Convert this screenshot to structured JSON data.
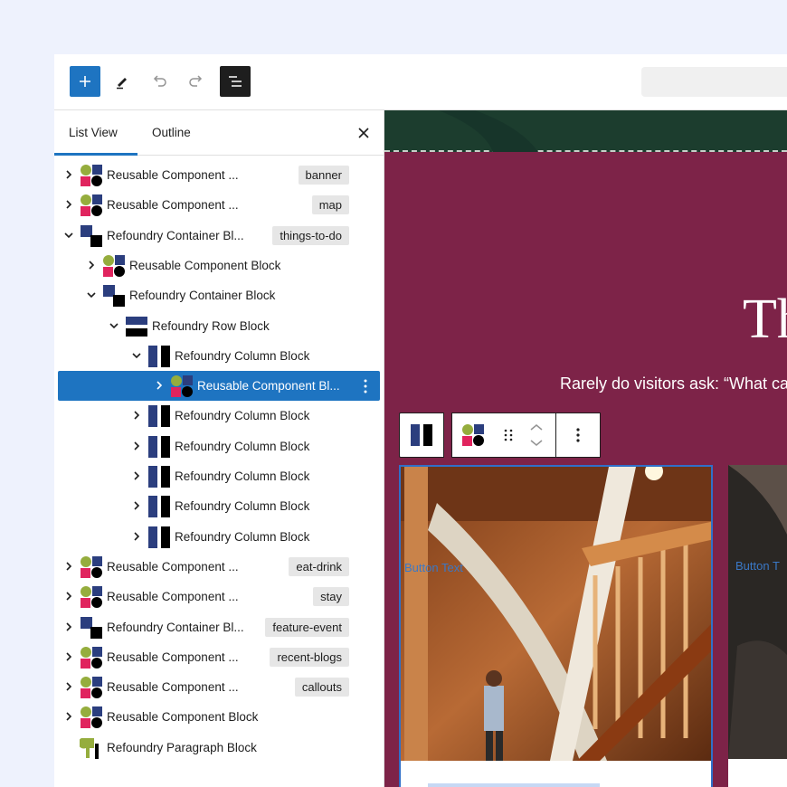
{
  "tabs": {
    "list_view": "List View",
    "outline": "Outline"
  },
  "tree": [
    {
      "label": "Reusable Component ...",
      "tag": "banner",
      "level": 0,
      "expanded": false,
      "icon": "reusable"
    },
    {
      "label": "Reusable Component ...",
      "tag": "map",
      "level": 0,
      "expanded": false,
      "icon": "reusable"
    },
    {
      "label": "Refoundry Container Bl...",
      "tag": "things-to-do",
      "level": 0,
      "expanded": true,
      "icon": "container"
    },
    {
      "label": "Reusable Component Block",
      "tag": "",
      "level": 1,
      "expanded": false,
      "icon": "reusable"
    },
    {
      "label": "Refoundry Container Block",
      "tag": "",
      "level": 1,
      "expanded": true,
      "icon": "container"
    },
    {
      "label": "Refoundry Row Block",
      "tag": "",
      "level": 2,
      "expanded": true,
      "icon": "row"
    },
    {
      "label": "Refoundry Column Block",
      "tag": "",
      "level": 3,
      "expanded": true,
      "icon": "column"
    },
    {
      "label": "Reusable Component Bl...",
      "tag": "",
      "level": 4,
      "expanded": false,
      "icon": "reusable",
      "selected": true
    },
    {
      "label": "Refoundry Column Block",
      "tag": "",
      "level": 3,
      "expanded": false,
      "icon": "column"
    },
    {
      "label": "Refoundry Column Block",
      "tag": "",
      "level": 3,
      "expanded": false,
      "icon": "column"
    },
    {
      "label": "Refoundry Column Block",
      "tag": "",
      "level": 3,
      "expanded": false,
      "icon": "column"
    },
    {
      "label": "Refoundry Column Block",
      "tag": "",
      "level": 3,
      "expanded": false,
      "icon": "column"
    },
    {
      "label": "Refoundry Column Block",
      "tag": "",
      "level": 3,
      "expanded": false,
      "icon": "column"
    },
    {
      "label": "Reusable Component ...",
      "tag": "eat-drink",
      "level": 0,
      "expanded": false,
      "icon": "reusable"
    },
    {
      "label": "Reusable Component ...",
      "tag": "stay",
      "level": 0,
      "expanded": false,
      "icon": "reusable"
    },
    {
      "label": "Refoundry Container Bl...",
      "tag": "feature-event",
      "level": 0,
      "expanded": false,
      "icon": "container"
    },
    {
      "label": "Reusable Component ...",
      "tag": "recent-blogs",
      "level": 0,
      "expanded": false,
      "icon": "reusable"
    },
    {
      "label": "Reusable Component ...",
      "tag": "callouts",
      "level": 0,
      "expanded": false,
      "icon": "reusable"
    },
    {
      "label": "Reusable Component Block",
      "tag": "",
      "level": 0,
      "expanded": false,
      "icon": "reusable"
    },
    {
      "label": "Refoundry Paragraph Block",
      "tag": "",
      "level": 0,
      "expanded": null,
      "icon": "paragraph"
    }
  ],
  "canvas": {
    "title": "Th",
    "subtitle": "Rarely do visitors ask: “What ca",
    "button_text_1": "Button Text",
    "button_text_2": "Button T"
  },
  "colors": {
    "accent": "#1e74c1",
    "canvas_bg": "#7d2348",
    "hero": "#1c3d2e"
  }
}
